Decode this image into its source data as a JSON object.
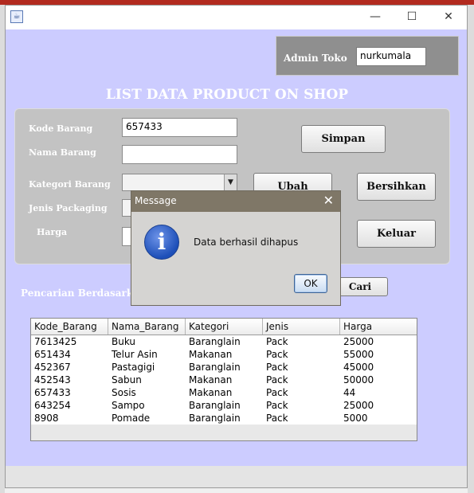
{
  "window": {
    "close_glyph": "✕",
    "minimize_glyph": "—",
    "maximize_glyph": "☐",
    "icon": "java-app-icon"
  },
  "admin": {
    "label": "Admin Toko",
    "value": "nurkumala"
  },
  "page_title": "LIST DATA PRODUCT ON SHOP",
  "form": {
    "kode_label": "Kode Barang",
    "kode_value": "657433",
    "nama_label": "Nama Barang",
    "nama_value": "",
    "kategori_label": "Kategori Barang",
    "kategori_value": "",
    "jenis_label": "Jenis Packaging",
    "harga_label": "Harga",
    "harga_value": ""
  },
  "buttons": {
    "simpan": "Simpan",
    "ubah": "Ubah",
    "bersihkan": "Bersihkan",
    "keluar": "Keluar",
    "cari": "Cari"
  },
  "search": {
    "label": "Pencarian Berdasarkan"
  },
  "table": {
    "headers": [
      "Kode_Barang",
      "Nama_Barang",
      "Kategori",
      "Jenis",
      "Harga"
    ],
    "rows": [
      [
        "7613425",
        "Buku",
        "Baranglain",
        "Pack",
        "25000"
      ],
      [
        "651434",
        "Telur Asin",
        "Makanan",
        "Pack",
        "55000"
      ],
      [
        "452367",
        "Pastagigi",
        "Baranglain",
        "Pack",
        "45000"
      ],
      [
        "452543",
        "Sabun",
        "Makanan",
        "Pack",
        "50000"
      ],
      [
        "657433",
        "Sosis",
        "Makanan",
        "Pack",
        "44"
      ],
      [
        "643254",
        "Sampo",
        "Baranglain",
        "Pack",
        "25000"
      ],
      [
        "8908",
        "Pomade",
        "Baranglain",
        "Pack",
        "5000"
      ]
    ]
  },
  "dialog": {
    "title": "Message",
    "close_glyph": "✕",
    "message": "Data berhasil dihapus",
    "ok": "OK",
    "icon": "info-icon"
  },
  "colors": {
    "content_bg": "#ccccff",
    "panel_bg": "#c3c3c3",
    "admin_panel_bg": "#8f8f8f",
    "dialog_title_bg": "#7f7767"
  }
}
